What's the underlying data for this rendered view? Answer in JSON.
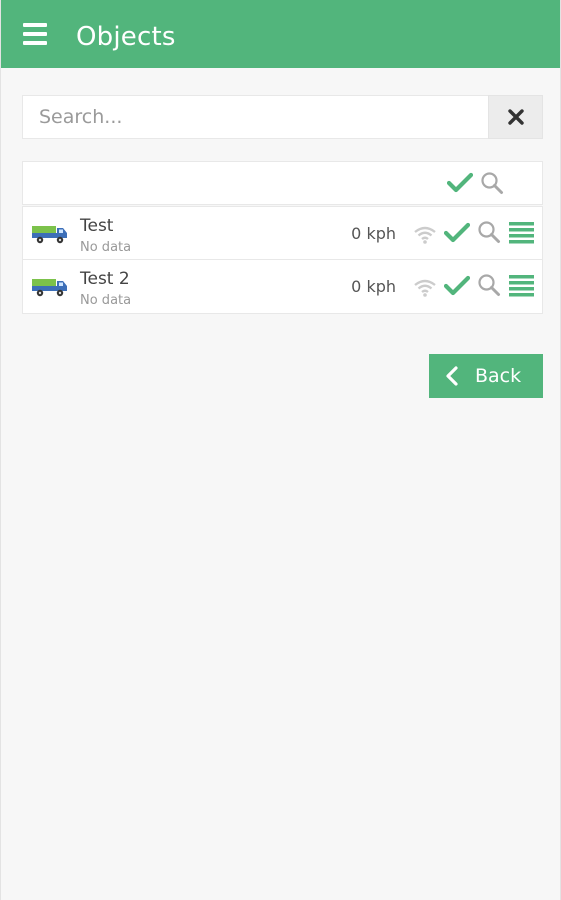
{
  "header": {
    "title": "Objects",
    "menu_icon": "hamburger-menu-icon"
  },
  "search": {
    "placeholder": "Search...",
    "value": "",
    "clear_icon": "close-icon"
  },
  "list": {
    "header_icons": [
      "check-icon",
      "search-icon"
    ],
    "rows": [
      {
        "name": "Test",
        "status": "No data",
        "speed": "0 kph"
      },
      {
        "name": "Test 2",
        "status": "No data",
        "speed": "0 kph"
      }
    ]
  },
  "buttons": {
    "back_label": "Back"
  },
  "colors": {
    "brand": "#52b57c",
    "background": "#f7f7f7",
    "icon_gray": "#a8a8a8"
  }
}
